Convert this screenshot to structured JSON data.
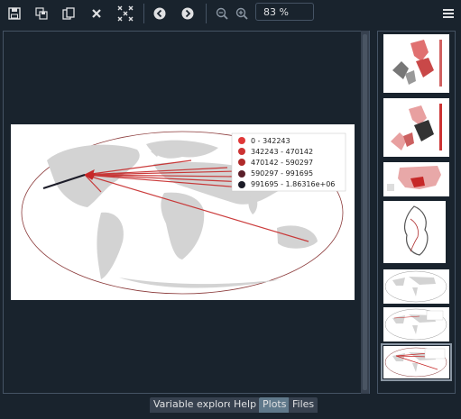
{
  "toolbar": {
    "zoom_value": "83 %",
    "icons": [
      "save-icon",
      "save-all-icon",
      "copy-icon",
      "close-icon",
      "close-all-icon",
      "back-arrow-icon",
      "forward-arrow-icon",
      "zoom-out-icon",
      "zoom-in-icon",
      "menu-icon"
    ]
  },
  "plot": {
    "legend": [
      {
        "label": "0 - 342243",
        "color": "#e03838"
      },
      {
        "label": "342243 - 470142",
        "color": "#cc3333"
      },
      {
        "label": "470142 - 590297",
        "color": "#b02a2a"
      },
      {
        "label": "590297 - 991695",
        "color": "#5a1f2a"
      },
      {
        "label": "991695 - 1.86316e+06",
        "color": "#1c1c28"
      }
    ]
  },
  "tabs": [
    {
      "label": "Variable explorer",
      "active": false
    },
    {
      "label": "Help",
      "active": false
    },
    {
      "label": "Plots",
      "active": true
    },
    {
      "label": "Files",
      "active": false
    }
  ],
  "colors": {
    "background": "#19232d",
    "border": "#455364",
    "tab_active": "#60798b"
  }
}
